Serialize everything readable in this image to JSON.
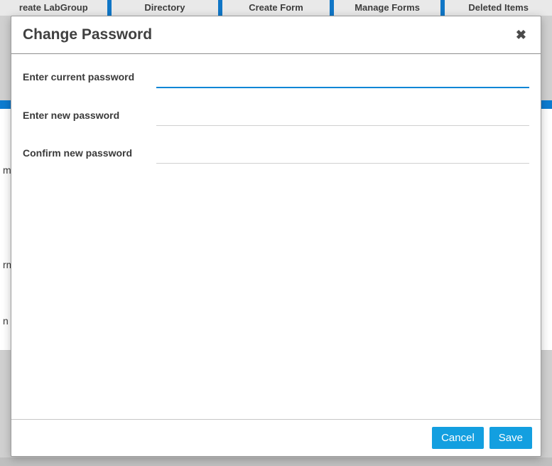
{
  "bgNav": {
    "items": [
      "reate LabGroup",
      "Directory",
      "Create Form",
      "Manage Forms",
      "Deleted Items"
    ]
  },
  "bgRows": [
    "m",
    "rm",
    "n"
  ],
  "modal": {
    "title": "Change Password",
    "closeGlyph": "✖",
    "fields": {
      "current": {
        "label": "Enter current password",
        "value": ""
      },
      "new": {
        "label": "Enter new password",
        "value": ""
      },
      "confirm": {
        "label": "Confirm new password",
        "value": ""
      }
    },
    "footer": {
      "cancel": "Cancel",
      "save": "Save"
    }
  }
}
